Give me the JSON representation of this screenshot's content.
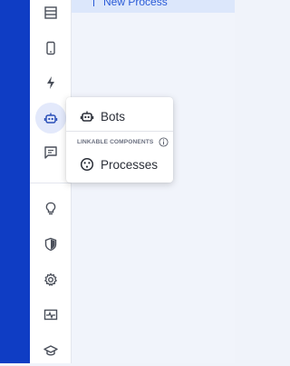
{
  "header": {
    "new_process_label": "New Process"
  },
  "sidebar": {
    "items": [
      {
        "icon": "database-icon"
      },
      {
        "icon": "phone-icon"
      },
      {
        "icon": "lightning-icon"
      },
      {
        "icon": "bot-icon",
        "active": true
      },
      {
        "icon": "chat-icon"
      },
      {
        "icon": "lightbulb-icon"
      },
      {
        "icon": "shield-icon"
      },
      {
        "icon": "gear-icon"
      },
      {
        "icon": "monitor-pulse-icon"
      },
      {
        "icon": "graduation-cap-icon"
      }
    ]
  },
  "menu": {
    "bots_label": "Bots",
    "section_label": "LINKABLE COMPONENTS",
    "processes_label": "Processes"
  },
  "colors": {
    "accent": "#0f3dc4",
    "active_bg": "#e3e9fb",
    "link": "#2a5bd7"
  }
}
